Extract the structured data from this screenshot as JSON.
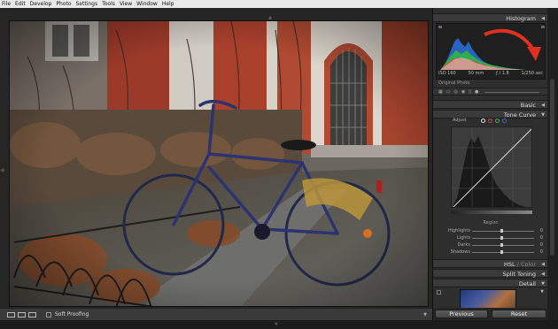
{
  "menu": [
    "File",
    "Edit",
    "Develop",
    "Photo",
    "Settings",
    "Tools",
    "View",
    "Window",
    "Help"
  ],
  "histogram": {
    "title": "Histogram",
    "iso": "ISO 160",
    "focal": "50 mm",
    "aperture": "ƒ / 1.8",
    "shutter": "1/250 sec",
    "original_photo": "Original Photo"
  },
  "panels": {
    "basic": "Basic",
    "tone_curve": "Tone Curve",
    "hsl_main": "HSL",
    "hsl_sep": " / ",
    "hsl_color": "Color",
    "split_toning": "Split Toning",
    "detail": "Detail"
  },
  "tone_curve": {
    "adjust": "Adjust",
    "region": "Region",
    "rows": [
      {
        "label": "Highlights",
        "value": "0"
      },
      {
        "label": "Lights",
        "value": "0"
      },
      {
        "label": "Darks",
        "value": "0"
      },
      {
        "label": "Shadows",
        "value": "0"
      }
    ],
    "channel_colors": [
      "#e0e0e0",
      "#d04040",
      "#40b040",
      "#4060d0"
    ]
  },
  "toolbar": {
    "soft_proofing": "Soft Proofing"
  },
  "buttons": {
    "previous": "Previous",
    "reset": "Reset"
  },
  "colors": {
    "histogram_arrow": "#e0301e",
    "panel_bg": "#2e2e2e",
    "menu_bg": "#e9e9e9"
  }
}
